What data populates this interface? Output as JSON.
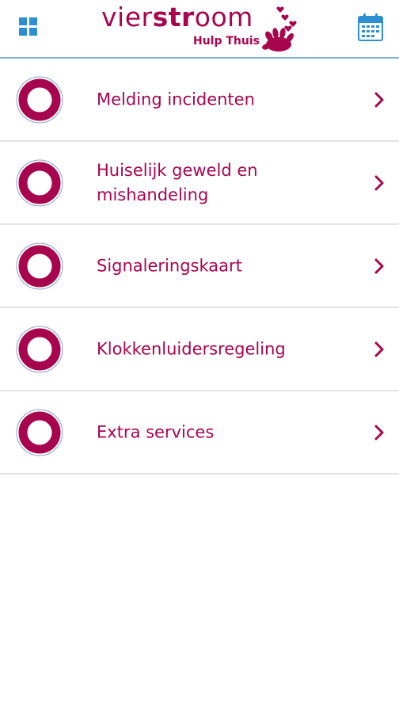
{
  "header": {
    "logo": {
      "brand_prefix": "vier",
      "brand_strong": "str",
      "brand_suffix": "oom",
      "subtitle": "Hulp Thuis"
    },
    "left_icon": "grid-menu-icon",
    "right_icon": "calendar-icon"
  },
  "colors": {
    "accent": "#a8054f",
    "icon_blue": "#2d8fd2",
    "header_border": "#7fb3d9",
    "divider": "#e4e4e4"
  },
  "menu": {
    "items": [
      {
        "label": "Melding incidenten",
        "icon": "ring-icon"
      },
      {
        "label": "Huiselijk geweld en mishandeling",
        "icon": "ring-icon"
      },
      {
        "label": "Signaleringskaart",
        "icon": "ring-icon"
      },
      {
        "label": "Klokkenluidersregeling",
        "icon": "ring-icon"
      },
      {
        "label": "Extra services",
        "icon": "ring-icon"
      }
    ]
  }
}
